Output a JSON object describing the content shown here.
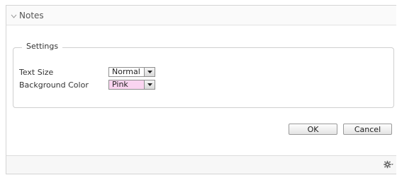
{
  "panel": {
    "title": "Notes",
    "header_icon": "chevron-down-icon"
  },
  "settings": {
    "legend": "Settings",
    "text_size": {
      "label": "Text Size",
      "value": "Normal"
    },
    "background_color": {
      "label": "Background Color",
      "value": "Pink"
    }
  },
  "buttons": {
    "ok": "OK",
    "cancel": "Cancel"
  },
  "footer": {
    "icon": "gear-icon"
  },
  "colors": {
    "pink_swatch": "#fad4f0",
    "border": "#d4d4d4"
  }
}
